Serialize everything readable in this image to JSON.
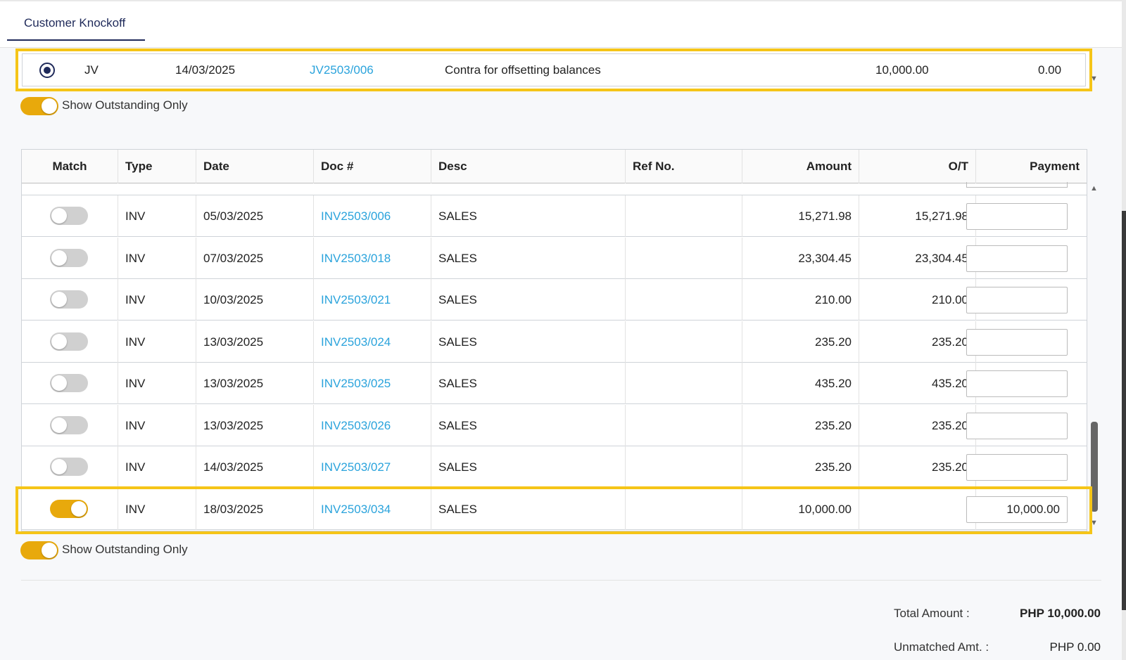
{
  "tab": {
    "label": "Customer Knockoff"
  },
  "jv": {
    "type": "JV",
    "date": "14/03/2025",
    "doc": "JV2503/006",
    "desc": "Contra for offsetting balances",
    "amount": "10,000.00",
    "ot": "0.00"
  },
  "filter": {
    "label": "Show Outstanding Only"
  },
  "table": {
    "headers": {
      "match": "Match",
      "type": "Type",
      "date": "Date",
      "doc": "Doc #",
      "desc": "Desc",
      "ref": "Ref No.",
      "amount": "Amount",
      "ot": "O/T",
      "payment": "Payment"
    },
    "rows": [
      {
        "match": false,
        "type": "INV",
        "date": "05/03/2025",
        "doc": "INV2503/006",
        "desc": "SALES",
        "ref": "",
        "amount": "15,271.98",
        "ot": "15,271.98",
        "payment": ""
      },
      {
        "match": false,
        "type": "INV",
        "date": "07/03/2025",
        "doc": "INV2503/018",
        "desc": "SALES",
        "ref": "",
        "amount": "23,304.45",
        "ot": "23,304.45",
        "payment": ""
      },
      {
        "match": false,
        "type": "INV",
        "date": "10/03/2025",
        "doc": "INV2503/021",
        "desc": "SALES",
        "ref": "",
        "amount": "210.00",
        "ot": "210.00",
        "payment": ""
      },
      {
        "match": false,
        "type": "INV",
        "date": "13/03/2025",
        "doc": "INV2503/024",
        "desc": "SALES",
        "ref": "",
        "amount": "235.20",
        "ot": "235.20",
        "payment": ""
      },
      {
        "match": false,
        "type": "INV",
        "date": "13/03/2025",
        "doc": "INV2503/025",
        "desc": "SALES",
        "ref": "",
        "amount": "435.20",
        "ot": "435.20",
        "payment": ""
      },
      {
        "match": false,
        "type": "INV",
        "date": "13/03/2025",
        "doc": "INV2503/026",
        "desc": "SALES",
        "ref": "",
        "amount": "235.20",
        "ot": "235.20",
        "payment": ""
      },
      {
        "match": false,
        "type": "INV",
        "date": "14/03/2025",
        "doc": "INV2503/027",
        "desc": "SALES",
        "ref": "",
        "amount": "235.20",
        "ot": "235.20",
        "payment": ""
      },
      {
        "match": true,
        "type": "INV",
        "date": "18/03/2025",
        "doc": "INV2503/034",
        "desc": "SALES",
        "ref": "",
        "amount": "10,000.00",
        "ot": "",
        "payment": "10,000.00"
      }
    ]
  },
  "totals": {
    "total_label": "Total Amount :",
    "total_value": "PHP 10,000.00",
    "unmatched_label": "Unmatched Amt. :",
    "unmatched_value": "PHP 0.00"
  },
  "colors": {
    "accent": "#e8a90c",
    "highlight": "#f5c518",
    "link": "#2aa3dc",
    "tab": "#1f2a5a"
  }
}
